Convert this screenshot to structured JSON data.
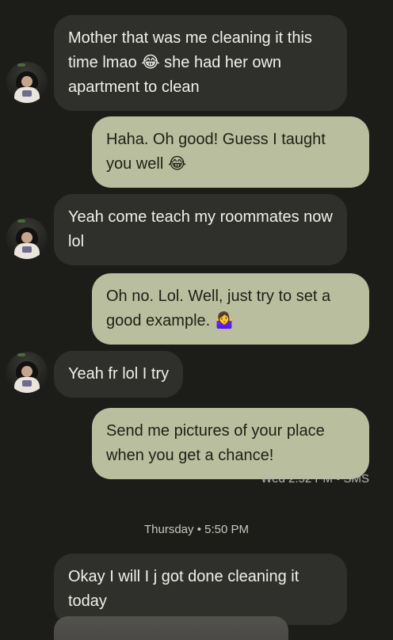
{
  "conversation": {
    "messages": [
      {
        "direction": "incoming",
        "text": "Mother that was me cleaning it this time lmao 😂 she had her own apartment to clean"
      },
      {
        "direction": "outgoing",
        "text": "Haha. Oh good! Guess I taught you well 😂"
      },
      {
        "direction": "incoming",
        "text": "Yeah come teach my roommates now lol"
      },
      {
        "direction": "outgoing",
        "text": "Oh no. Lol. Well, just try to set a good example. 🤷‍♀️"
      },
      {
        "direction": "incoming",
        "text": "Yeah fr lol I try"
      },
      {
        "direction": "outgoing",
        "text": "Send me pictures of your place when you get a chance!"
      },
      {
        "direction": "incoming",
        "text": "Okay I will I j got done cleaning it today"
      }
    ],
    "status": "Wed 2:52 PM • SMS",
    "divider": "Thursday • 5:50 PM"
  },
  "colors": {
    "background": "#1c1c19",
    "incoming_bubble": "#2f2f2c",
    "outgoing_bubble": "#b9bf9e"
  }
}
